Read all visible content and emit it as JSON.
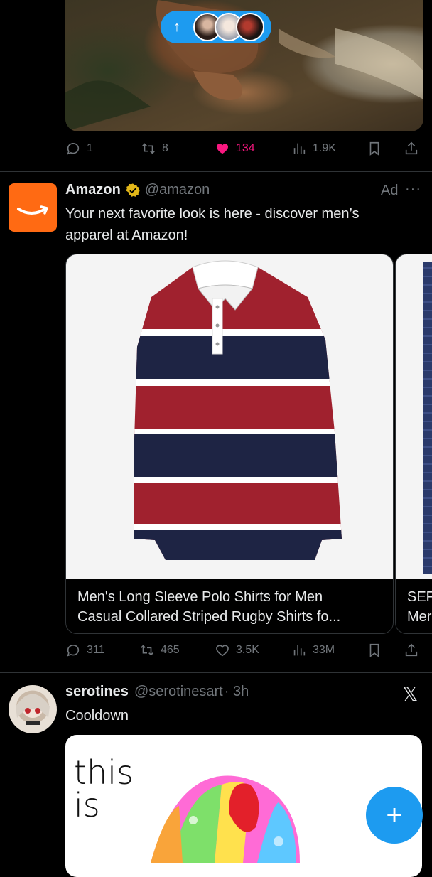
{
  "top_post": {
    "new_posts_button": "↑",
    "actions": {
      "replies": "1",
      "reposts": "8",
      "likes": "134",
      "views": "1.9K"
    }
  },
  "ad_post": {
    "display_name": "Amazon",
    "handle": "@amazon",
    "ad_label": "Ad",
    "more": "···",
    "text_line1": "Your next favorite look is here - discover men’s",
    "text_line2": "apparel at Amazon!",
    "card_title_line1": "Men's Long Sleeve Polo Shirts for Men",
    "card_title_line2": "Casual Collared Striped Rugby Shirts fo...",
    "card2_title_line1": "SEF",
    "card2_title_line2": "Mer",
    "actions": {
      "replies": "311",
      "reposts": "465",
      "likes": "3.5K",
      "views": "33M"
    }
  },
  "next_post": {
    "display_name": "serotines",
    "handle": "@serotinesart",
    "time": "· 3h",
    "text": "Cooldown",
    "image_text_line1": "this",
    "image_text_line2": "is",
    "x_logo": "𝕏"
  },
  "fab": {
    "label": "+"
  },
  "colors": {
    "accent": "#1d9bf0",
    "like": "#f91880",
    "amazon": "#ff6a13",
    "verified": "#e2b719"
  },
  "icons": [
    "up-arrow-icon",
    "reply-icon",
    "repost-icon",
    "heart-icon",
    "views-icon",
    "bookmark-icon",
    "share-icon",
    "verified-badge-icon",
    "more-icon",
    "x-logo-icon",
    "plus-icon"
  ]
}
